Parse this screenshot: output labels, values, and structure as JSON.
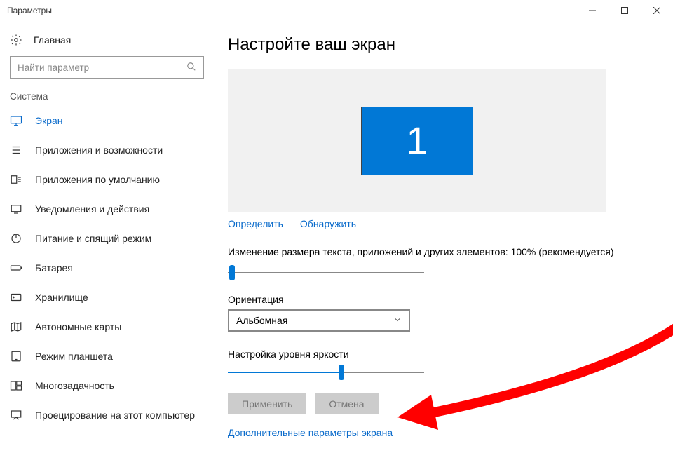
{
  "window": {
    "title": "Параметры"
  },
  "sidebar": {
    "home": "Главная",
    "search_placeholder": "Найти параметр",
    "section": "Система",
    "items": [
      {
        "label": "Экран"
      },
      {
        "label": "Приложения и возможности"
      },
      {
        "label": "Приложения по умолчанию"
      },
      {
        "label": "Уведомления и действия"
      },
      {
        "label": "Питание и спящий режим"
      },
      {
        "label": "Батарея"
      },
      {
        "label": "Хранилище"
      },
      {
        "label": "Автономные карты"
      },
      {
        "label": "Режим планшета"
      },
      {
        "label": "Многозадачность"
      },
      {
        "label": "Проецирование на этот компьютер"
      }
    ]
  },
  "main": {
    "title": "Настройте ваш экран",
    "monitor_number": "1",
    "identify": "Определить",
    "detect": "Обнаружить",
    "scale_label": "Изменение размера текста, приложений и других элементов: 100% (рекомендуется)",
    "orientation_label": "Ориентация",
    "orientation_value": "Альбомная",
    "brightness_label": "Настройка уровня яркости",
    "apply": "Применить",
    "cancel": "Отмена",
    "advanced_link": "Дополнительные параметры экрана"
  }
}
